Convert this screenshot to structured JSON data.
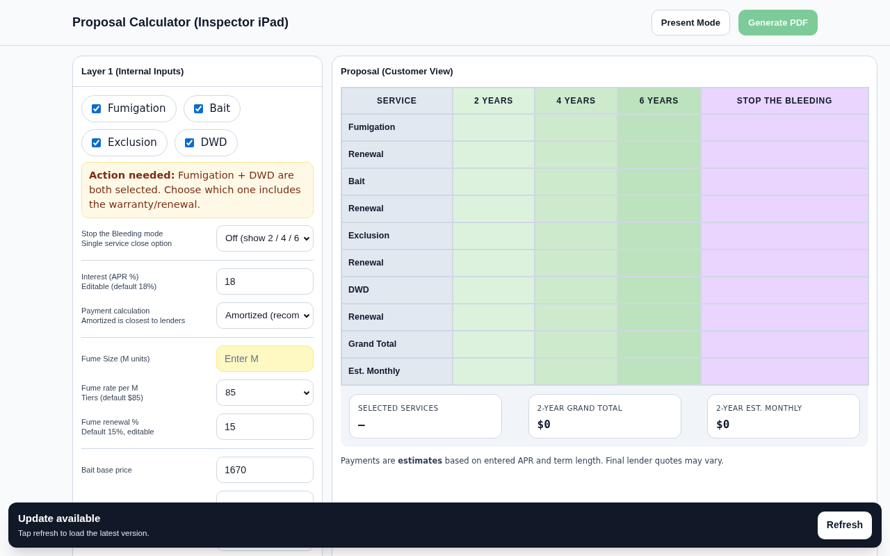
{
  "header": {
    "title": "Proposal Calculator (Inspector iPad)",
    "buttons": [
      {
        "label": "Present Mode",
        "disabled": false
      },
      {
        "label": "Generate PDF",
        "disabled": true
      }
    ]
  },
  "inputs_panel": {
    "title": "Layer 1 (Internal Inputs)",
    "services": [
      {
        "label": "Fumigation",
        "checked": true
      },
      {
        "label": "Bait",
        "checked": true
      },
      {
        "label": "Exclusion",
        "checked": true
      },
      {
        "label": "DWD",
        "checked": true
      }
    ],
    "alert": "**Action needed:** Fumigation + DWD are both selected. Choose which one includes the warranty/renewal.",
    "groups": [
      [
        {
          "label": "Stop the Bleeding mode",
          "hint": "Single service close option",
          "kind": "select",
          "value": "Off (show 2 / 4 / 6"
        }
      ],
      [
        {
          "label": "Interest (APR %)",
          "hint": "Editable (default 18%)",
          "kind": "input",
          "value": "18"
        },
        {
          "label": "Payment calculation",
          "hint": "Amortized is closest to lenders",
          "kind": "select",
          "value": "Amortized (recom"
        }
      ],
      [
        {
          "label": "Fume Size (M units)",
          "kind": "input",
          "placeholder": "Enter M",
          "highlighted": true
        },
        {
          "label": "Fume rate per M",
          "hint": "Tiers (default $85)",
          "kind": "select",
          "value": "85"
        },
        {
          "label": "Fume renewal %",
          "hint": "Default 15%, editable",
          "kind": "input",
          "value": "15"
        }
      ],
      [
        {
          "label": "Bait base price",
          "kind": "input",
          "value": "1670"
        },
        {
          "kind": "input"
        },
        {
          "kind": "input"
        }
      ]
    ]
  },
  "proposal_panel": {
    "title": "Proposal (Customer View)",
    "table": {
      "columns": [
        {
          "label": "SERVICE",
          "color": "#e2e8f0"
        },
        {
          "label": "2 YEARS",
          "color": "#ddf2dd"
        },
        {
          "label": "4 YEARS",
          "color": "#cdeacd"
        },
        {
          "label": "6 YEARS",
          "color": "#bce3bd"
        },
        {
          "label": "STOP THE BLEEDING",
          "color": "#e9d5ff"
        }
      ],
      "rows": [
        "Fumigation",
        "Renewal",
        "Bait",
        "Renewal",
        "Exclusion",
        "Renewal",
        "DWD",
        "Renewal",
        "Grand Total",
        "Est. Monthly"
      ]
    },
    "summary": [
      {
        "label": "SELECTED SERVICES",
        "value": "—"
      },
      {
        "label": "2-YEAR GRAND TOTAL",
        "value": "$0"
      },
      {
        "label": "2-YEAR EST. MONTHLY",
        "value": "$0"
      }
    ],
    "note": "Payments are **estimates** based on entered APR and term length. Final lender quotes may vary."
  },
  "toast": {
    "title": "Update available",
    "message": "Tap refresh to load the latest version.",
    "button": "Refresh"
  }
}
